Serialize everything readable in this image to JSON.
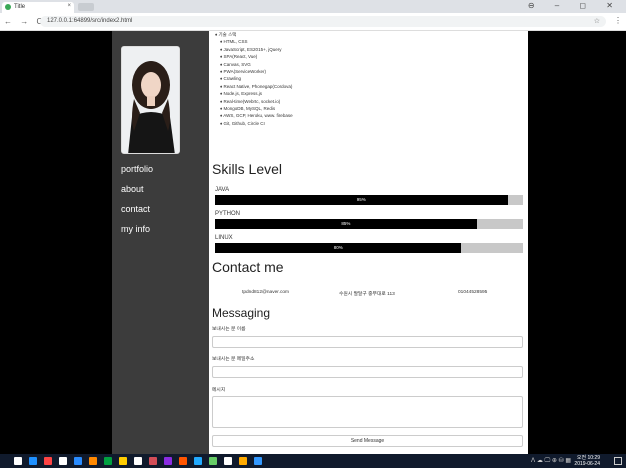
{
  "browser": {
    "tab_title": "Title",
    "tab_close": "×",
    "window_controls": "⊖ – ◻ ✕",
    "nav_buttons": "← → C ⓘ",
    "url": "127.0.0.1:64899/src/index2.html",
    "menu": "⋮",
    "bookmark": "☆"
  },
  "sidebar": {
    "links": [
      "portfolio",
      "about",
      "contact",
      "my info"
    ]
  },
  "skills_list": {
    "heading": "♦ 기술 스택",
    "items": [
      "♦ HTML, CSS",
      "♦ JavaScript, ES2015+, jQuery",
      "♦ SPA(React, Vue)",
      "♦ Canvas, SVG",
      "♦ PWA(ServiceWorker)",
      "♦ Crawling",
      "♦ React Native, Phonegap(Cordova)",
      "♦ Node.js, Express.js",
      "♦ Real-time(Webrtc, socket.io)",
      "♦ MongoDB, MySQL, Redis",
      "♦ AWS, GCP, Heroku, www. firebase",
      "♦ Git, Github, Circle CI"
    ]
  },
  "skills_level": {
    "title": "Skills Level",
    "bars": [
      {
        "name": "JAVA",
        "label": "95%",
        "value": 95
      },
      {
        "name": "PYTHON",
        "label": "85%",
        "value": 85
      },
      {
        "name": "LINUX",
        "label": "80%",
        "value": 80
      }
    ]
  },
  "contact": {
    "title": "Contact me",
    "email": "tpdnd812@naver.com",
    "address": "수원시 팔달구 중부대로 113",
    "phone": "01044528595"
  },
  "messaging": {
    "title": "Messaging",
    "name_label": "보내시는 분 이름",
    "email_label": "보내시는 분 메일주소",
    "message_label": "메시지",
    "send_label": "Send Message"
  },
  "taskbar": {
    "tray_text": "ᐱ ☁ 🖵 ⊕ ⛁ ▦",
    "time": "오전 10:29",
    "date": "2019-06-24",
    "icon_colors": [
      "#ffffff",
      "#1e90ff",
      "#ff4444",
      "#ffffff",
      "#2a8cff",
      "#ff8800",
      "#00a040",
      "#ffcc00",
      "#ffffff",
      "#d24d57",
      "#8a2be2",
      "#ff5500",
      "#22aaff",
      "#66cc66",
      "#ffffff",
      "#ffaa00",
      "#3399ff"
    ]
  }
}
